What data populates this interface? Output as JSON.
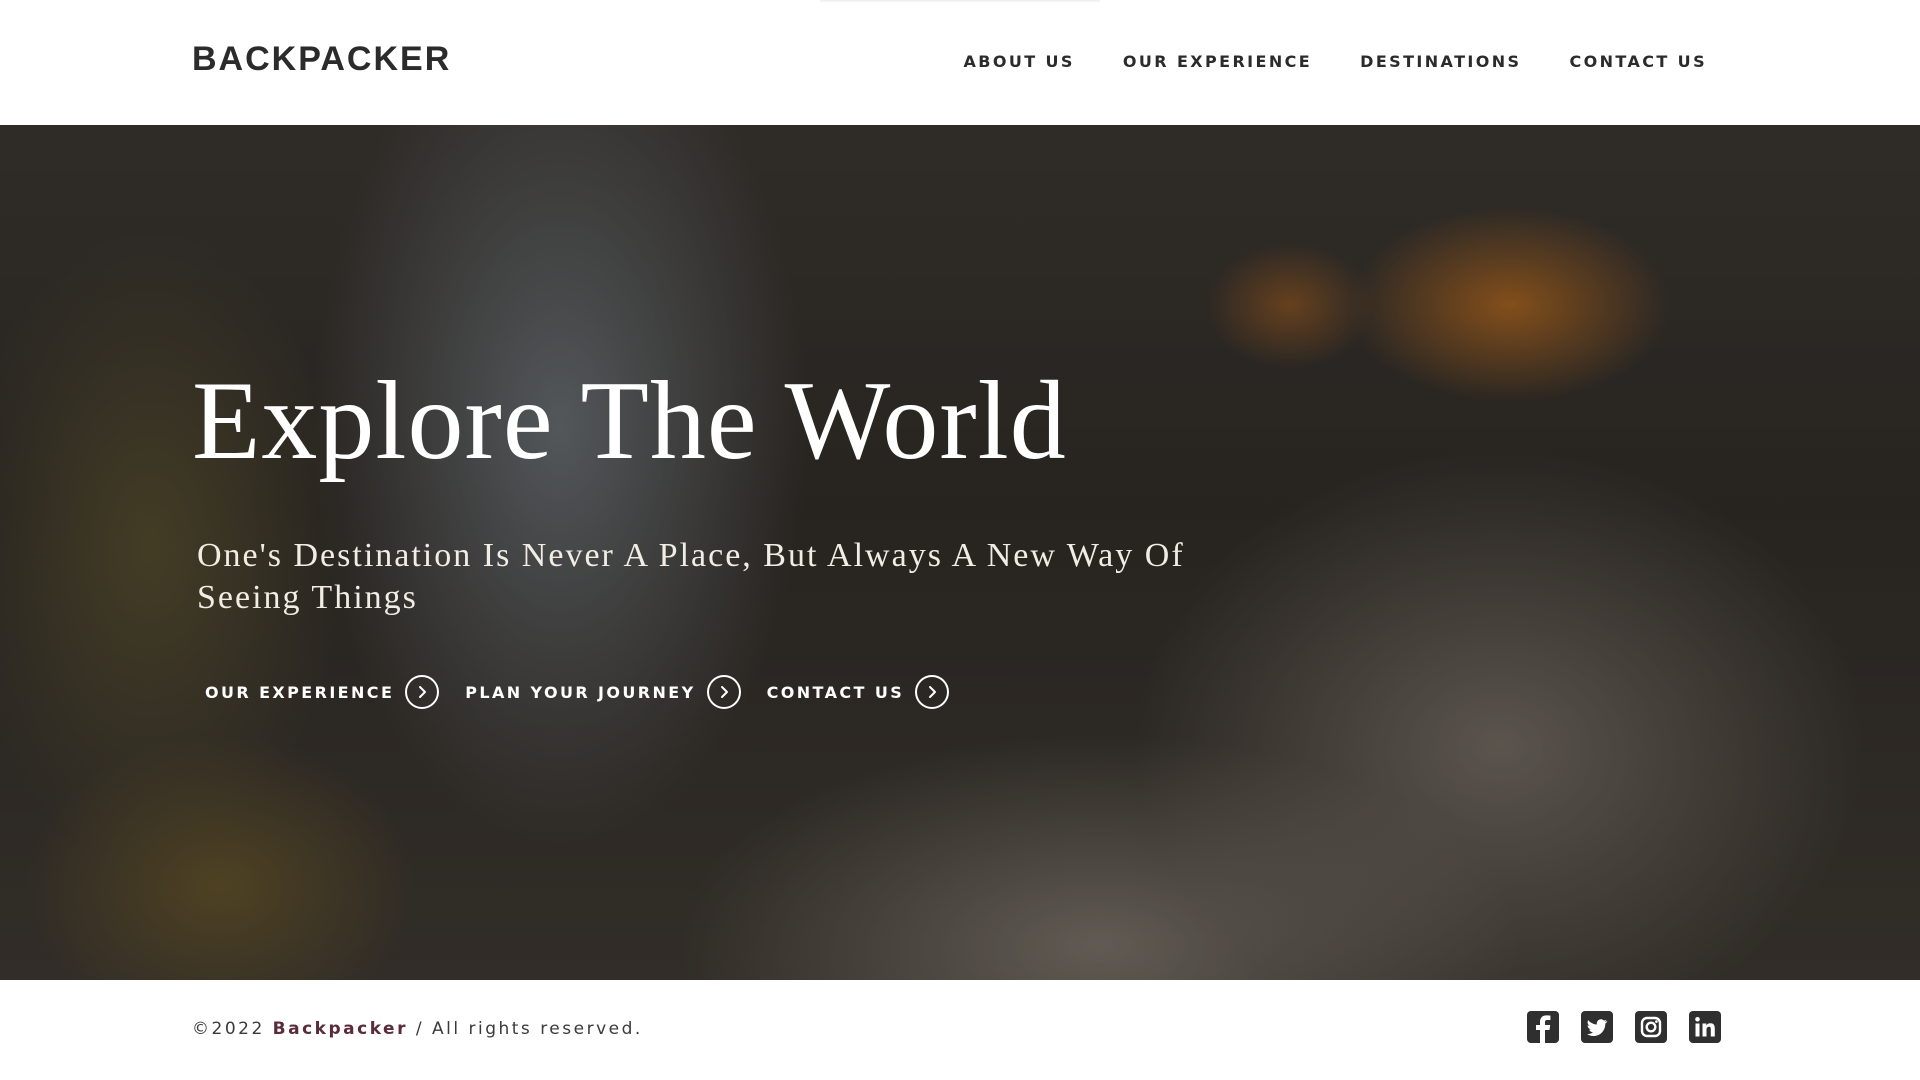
{
  "header": {
    "logo": "BACKPACKER",
    "nav": [
      {
        "label": "ABOUT US"
      },
      {
        "label": "OUR EXPERIENCE"
      },
      {
        "label": "DESTINATIONS"
      },
      {
        "label": "CONTACT US"
      }
    ]
  },
  "hero": {
    "title": "Explore The World",
    "subtitle": "One's Destination Is Never A Place, But Always A New Way Of Seeing Things",
    "actions": [
      {
        "label": "OUR EXPERIENCE",
        "icon": "chevron-right-circle-icon"
      },
      {
        "label": "PLAN YOUR JOURNEY",
        "icon": "chevron-right-circle-icon"
      },
      {
        "label": "CONTACT US",
        "icon": "chevron-right-circle-icon"
      }
    ]
  },
  "footer": {
    "copyright_prefix": "©2022",
    "brand": "Backpacker",
    "copyright_suffix": "/ All rights reserved.",
    "socials": [
      {
        "icon": "facebook-icon"
      },
      {
        "icon": "twitter-icon"
      },
      {
        "icon": "instagram-icon"
      },
      {
        "icon": "linkedin-icon"
      }
    ]
  },
  "colors": {
    "text_dark": "#2b2b2b",
    "brand_accent": "#5a2b3a",
    "hero_text": "#ffffff"
  }
}
